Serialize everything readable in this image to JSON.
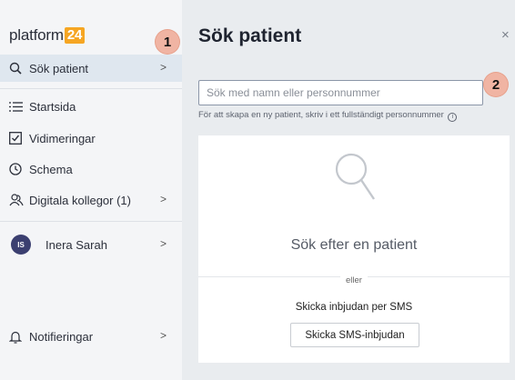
{
  "sidebar": {
    "logo_text": "platform",
    "logo_badge": "24",
    "items": [
      {
        "label": "Sök patient",
        "icon": "search-icon",
        "chevron": ">"
      },
      {
        "label": "Startsida",
        "icon": "list-icon"
      },
      {
        "label": "Vidimeringar",
        "icon": "checkbox-icon"
      },
      {
        "label": "Schema",
        "icon": "clock-icon"
      },
      {
        "label": "Digitala kollegor (1)",
        "icon": "people-icon",
        "chevron": ">"
      }
    ],
    "user": {
      "initials": "IS",
      "name": "Inera Sarah",
      "chevron": ">"
    },
    "notifications": {
      "label": "Notifieringar",
      "icon": "bell-icon",
      "chevron": ">"
    }
  },
  "callouts": {
    "one": "1",
    "two": "2"
  },
  "main": {
    "title": "Sök patient",
    "close": "×",
    "search_placeholder": "Sök med namn eller personnummer",
    "hint": "För att skapa en ny patient, skriv i ett fullständigt personnummer",
    "hint_icon": "i",
    "card": {
      "title": "Sök efter en patient",
      "or": "eller",
      "sms_label": "Skicka inbjudan per SMS",
      "sms_button": "Skicka SMS-inbjudan"
    }
  },
  "colors": {
    "accent": "#f6a623",
    "callout": "#f0b4a3",
    "active_bg": "#dfe7ef",
    "avatar_bg": "#3b3f70"
  }
}
